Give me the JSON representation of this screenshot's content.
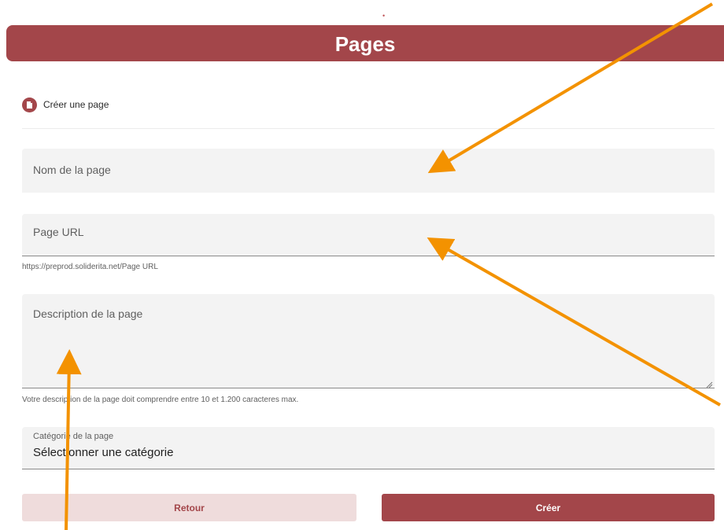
{
  "header": {
    "title": "Pages"
  },
  "section": {
    "title": "Créer une page",
    "icon": "page-add-icon"
  },
  "form": {
    "name": {
      "placeholder": "Nom de la page"
    },
    "url": {
      "placeholder": "Page URL",
      "helper": "https://preprod.soliderita.net/Page URL"
    },
    "description": {
      "placeholder": "Description de la page",
      "helper": "Votre description de la page doit comprendre entre 10 et 1.200 caracteres max."
    },
    "category": {
      "label": "Catégorie de la page",
      "value": "Sélectionner une catégorie"
    }
  },
  "buttons": {
    "back_label": "Retour",
    "create_label": "Créer"
  },
  "colors": {
    "brand": "#a3464a",
    "brand_light": "#efdcdc",
    "field_bg": "#f3f3f3",
    "annotation_arrow": "#f39200"
  }
}
